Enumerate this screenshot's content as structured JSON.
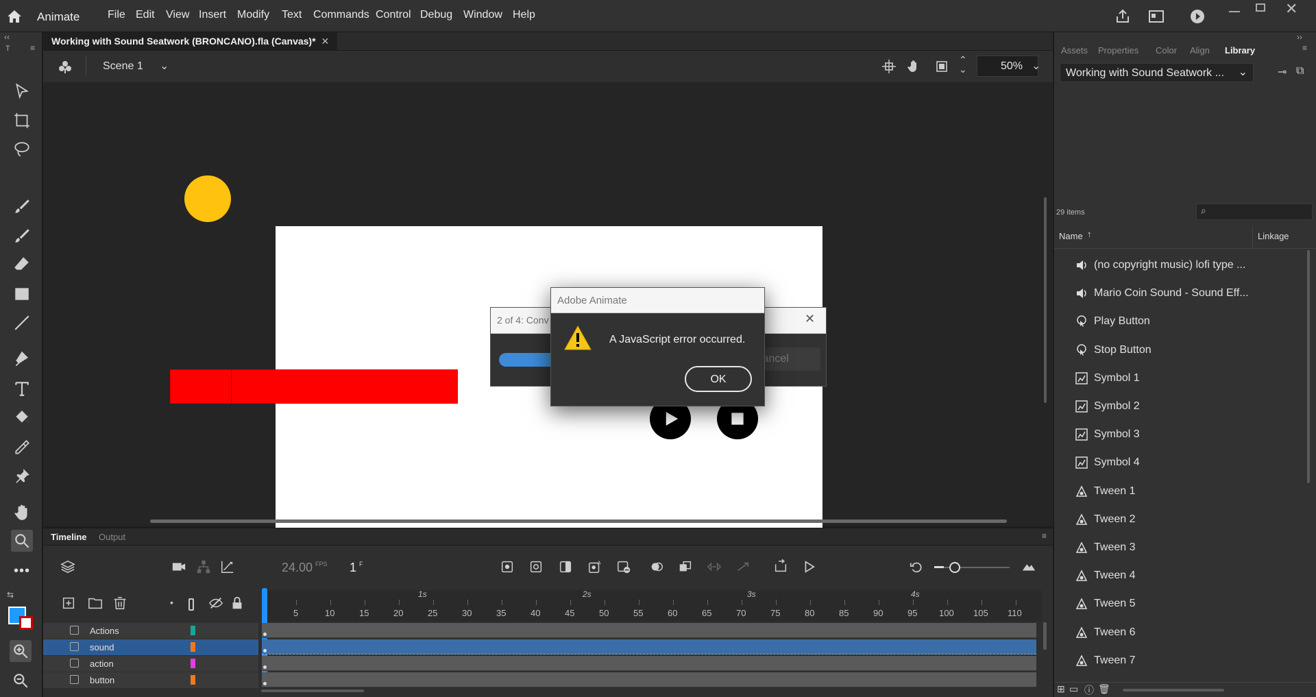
{
  "app": {
    "name": "Animate"
  },
  "menu": [
    "File",
    "Edit",
    "View",
    "Insert",
    "Modify",
    "Text",
    "Commands",
    "Control",
    "Debug",
    "Window",
    "Help"
  ],
  "document": {
    "tab_title": "Working with Sound Seatwork (BRONCANO).fla (Canvas)*",
    "scene": "Scene 1",
    "zoom": "50%"
  },
  "panels": {
    "tabs": [
      "Assets",
      "Properties",
      "Color",
      "Align",
      "Library"
    ],
    "active": "Library"
  },
  "library": {
    "dropdown": "Working with Sound Seatwork ...",
    "count": "29 items",
    "col_name": "Name",
    "col_linkage": "Linkage",
    "items": [
      {
        "label": "(no copyright music) lofi type ...",
        "icon": "sound-icon"
      },
      {
        "label": "Mario Coin Sound - Sound Eff...",
        "icon": "sound-icon"
      },
      {
        "label": "Play Button",
        "icon": "button-symbol-icon"
      },
      {
        "label": "Stop Button",
        "icon": "button-symbol-icon"
      },
      {
        "label": "Symbol 1",
        "icon": "movieclip-icon"
      },
      {
        "label": "Symbol 2",
        "icon": "movieclip-icon"
      },
      {
        "label": "Symbol 3",
        "icon": "movieclip-icon"
      },
      {
        "label": "Symbol 4",
        "icon": "movieclip-icon"
      },
      {
        "label": "Tween 1",
        "icon": "graphic-symbol-icon"
      },
      {
        "label": "Tween 2",
        "icon": "graphic-symbol-icon"
      },
      {
        "label": "Tween 3",
        "icon": "graphic-symbol-icon"
      },
      {
        "label": "Tween 4",
        "icon": "graphic-symbol-icon"
      },
      {
        "label": "Tween 5",
        "icon": "graphic-symbol-icon"
      },
      {
        "label": "Tween 6",
        "icon": "graphic-symbol-icon"
      },
      {
        "label": "Tween 7",
        "icon": "graphic-symbol-icon"
      }
    ]
  },
  "timeline": {
    "tabs": [
      "Timeline",
      "Output"
    ],
    "fps": "24.00",
    "fps_unit": "FPS",
    "frame": "1",
    "frame_unit": "F",
    "seconds": [
      "1s",
      "2s",
      "3s",
      "4s"
    ],
    "frame_numbers": [
      "5",
      "10",
      "15",
      "20",
      "25",
      "30",
      "35",
      "40",
      "45",
      "50",
      "55",
      "60",
      "65",
      "70",
      "75",
      "80",
      "85",
      "90",
      "95",
      "100",
      "105",
      "110"
    ],
    "layers": [
      {
        "name": "Actions",
        "color": "#1aa39a",
        "selected": false
      },
      {
        "name": "sound",
        "color": "#f07a1a",
        "selected": true
      },
      {
        "name": "action",
        "color": "#e040e0",
        "selected": false
      },
      {
        "name": "button",
        "color": "#f07a1a",
        "selected": false
      }
    ]
  },
  "progress_dialog": {
    "title": "2 of 4: Conv",
    "cancel": "Cancel",
    "progress": 0.15
  },
  "alert": {
    "title": "Adobe Animate",
    "message": "A JavaScript error occurred.",
    "ok": "OK"
  },
  "colors": {
    "stroke": "#1e9bff",
    "fill": "#cc0000",
    "accent": "#3d8bd9"
  }
}
